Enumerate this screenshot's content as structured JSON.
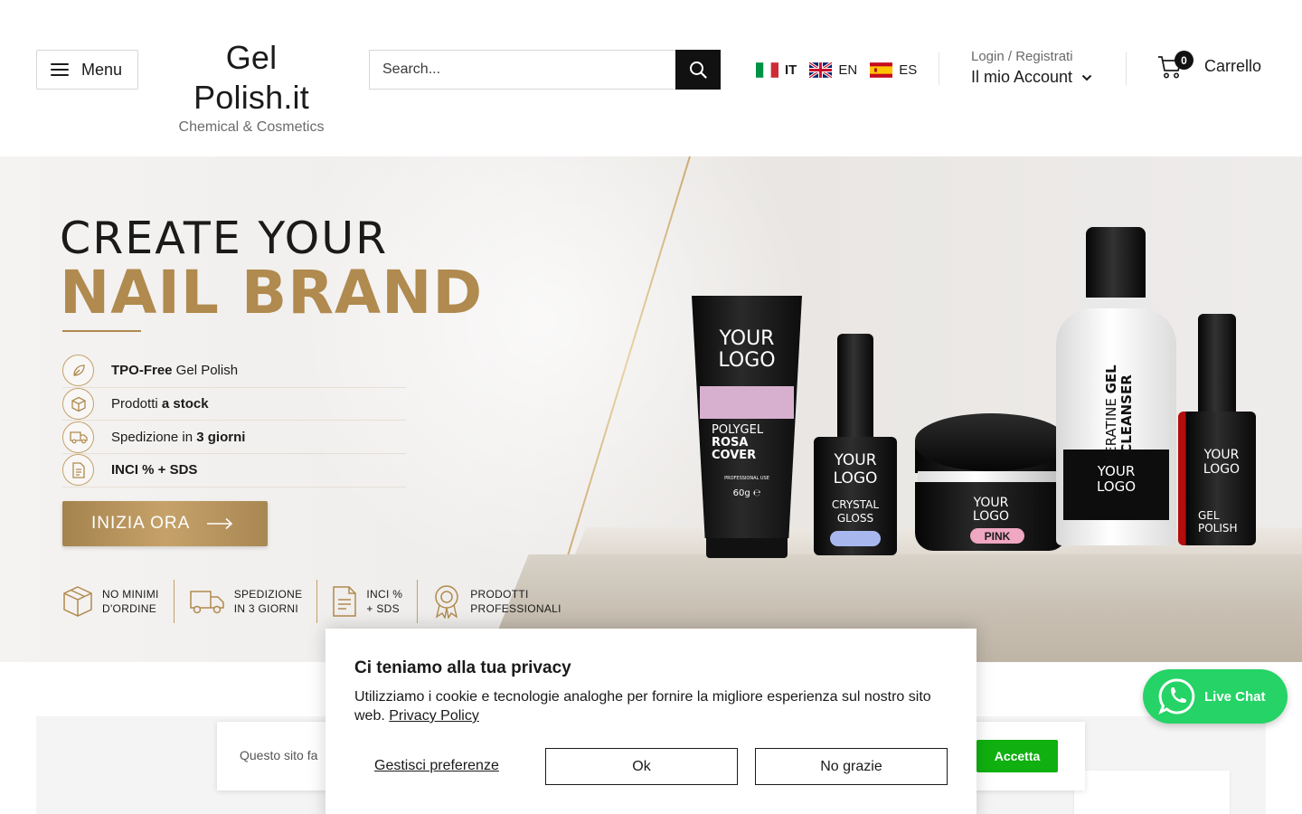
{
  "header": {
    "menu_label": "Menu",
    "logo_main": "Gel Polish.it",
    "logo_sub": "Chemical & Cosmetics",
    "search_placeholder": "Search...",
    "languages": [
      {
        "code": "IT",
        "flag": "italy-flag",
        "active": true
      },
      {
        "code": "EN",
        "flag": "uk-flag",
        "active": false
      },
      {
        "code": "ES",
        "flag": "spain-flag",
        "active": false
      }
    ],
    "account_small": "Login / Registrati",
    "account_big": "Il mio Account",
    "cart_count": "0",
    "cart_label": "Carrello"
  },
  "hero": {
    "title_line1": "CREATE YOUR",
    "title_line2": "NAIL BRAND",
    "features": [
      {
        "bold_prefix": "TPO-Free",
        "text": " Gel Polish",
        "icon": "leaf-icon"
      },
      {
        "text": "Prodotti ",
        "bold_suffix": "a stock",
        "icon": "box-icon"
      },
      {
        "text": "Spedizione in ",
        "bold_suffix": "3 giorni",
        "icon": "truck-icon"
      },
      {
        "bold_prefix": "INCI % + SDS",
        "text": "",
        "icon": "document-icon"
      }
    ],
    "cta_label": "INIZIA ORA",
    "badges": [
      {
        "line1": "NO MINIMI",
        "line2": "D'ORDINE",
        "icon": "box-icon"
      },
      {
        "line1": "SPEDIZIONE",
        "line2": "IN 3 GIORNI",
        "icon": "truck-icon"
      },
      {
        "line1": "INCI %",
        "line2": "+ SDS",
        "icon": "document-icon"
      },
      {
        "line1": "PRODOTTI",
        "line2": "PROFESSIONALI",
        "icon": "award-icon"
      }
    ],
    "products": {
      "tube": {
        "logo1": "YOUR",
        "logo2": "LOGO",
        "name1": "POLYGEL",
        "name2": "ROSA",
        "name3": "COVER",
        "small": "PROFESSIONAL USE",
        "weight": "60g ℮"
      },
      "bottle": {
        "logo1": "YOUR",
        "logo2": "LOGO",
        "name1": "CRYSTAL",
        "name2": "GLOSS"
      },
      "jar": {
        "logo1": "YOUR",
        "logo2": "LOGO",
        "pill": "PINK"
      },
      "cleanser": {
        "v1": "KERATINE",
        "v2": "GEL CLEANSER",
        "logo1": "YOUR",
        "logo2": "LOGO"
      },
      "red": {
        "logo1": "YOUR",
        "logo2": "LOGO",
        "name1": "GEL",
        "name2": "POLISH"
      }
    }
  },
  "notice": {
    "text": "Questo sito fa",
    "accept_label": "Accetta"
  },
  "cookie": {
    "title": "Ci teniamo alla tua privacy",
    "body": "Utilizziamo i cookie e tecnologie analoghe per fornire la migliore esperienza sul nostro sito web. ",
    "policy_link": "Privacy Policy",
    "manage_label": "Gestisci preferenze",
    "ok_label": "Ok",
    "decline_label": "No grazie"
  },
  "chat": {
    "label": "Live Chat",
    "icon": "whatsapp-icon"
  },
  "colors": {
    "gold": "#b08a4e",
    "accept_green": "#10b010",
    "whatsapp_green": "#25d366",
    "dark": "#111111"
  }
}
